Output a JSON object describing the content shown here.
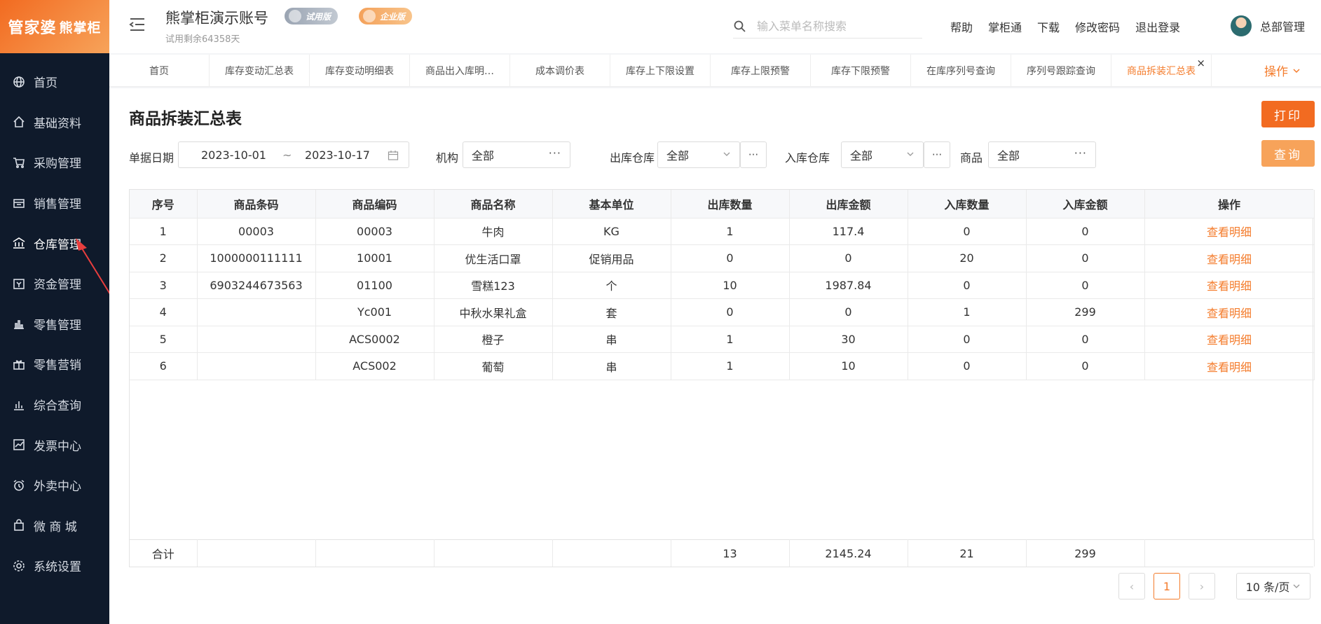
{
  "logo": {
    "text1": "管家婆",
    "text2": "熊掌柜"
  },
  "sidebar": {
    "items": [
      {
        "label": "首页",
        "icon": "globe-icon"
      },
      {
        "label": "基础资料",
        "icon": "home-icon"
      },
      {
        "label": "采购管理",
        "icon": "cart-icon"
      },
      {
        "label": "销售管理",
        "icon": "sales-icon"
      },
      {
        "label": "仓库管理",
        "icon": "bank-icon"
      },
      {
        "label": "资金管理",
        "icon": "money-icon"
      },
      {
        "label": "零售管理",
        "icon": "bar-chart-icon"
      },
      {
        "label": "零售营销",
        "icon": "gift-icon"
      },
      {
        "label": "综合查询",
        "icon": "stats-icon"
      },
      {
        "label": "发票中心",
        "icon": "line-chart-icon"
      },
      {
        "label": "外卖中心",
        "icon": "alarm-icon"
      },
      {
        "label": "微 商 城",
        "icon": "bag-icon"
      },
      {
        "label": "系统设置",
        "icon": "gear-icon"
      }
    ],
    "active_index": 4
  },
  "header": {
    "account_title": "熊掌柜演示账号",
    "trial_text": "试用剩余64358天",
    "badge_trial": "试用版",
    "badge_enterprise": "企业版",
    "search_placeholder": "输入菜单名称搜索",
    "links": [
      "帮助",
      "掌柜通",
      "下载",
      "修改密码",
      "退出登录"
    ],
    "user_name": "总部管理"
  },
  "tabs": {
    "items": [
      "首页",
      "库存变动汇总表",
      "库存变动明细表",
      "商品出入库明…",
      "成本调价表",
      "库存上下限设置",
      "库存上限预警",
      "库存下限预警",
      "在库序列号查询",
      "序列号跟踪查询",
      "商品拆装汇总表"
    ],
    "active_index": 10,
    "close_glyph": "×",
    "action_label": "操作"
  },
  "main": {
    "title": "商品拆装汇总表",
    "print_label": "打印",
    "query_label": "查询"
  },
  "filters": {
    "date_label": "单据日期",
    "date_start": "2023-10-01",
    "date_sep": "~",
    "date_end": "2023-10-17",
    "org_label": "机构",
    "org_value": "全部",
    "out_wh_label": "出库仓库",
    "out_wh_value": "全部",
    "in_wh_label": "入库仓库",
    "in_wh_value": "全部",
    "goods_label": "商品",
    "goods_value": "全部",
    "dots": "···"
  },
  "table": {
    "columns": [
      "序号",
      "商品条码",
      "商品编码",
      "商品名称",
      "基本单位",
      "出库数量",
      "出库金额",
      "入库数量",
      "入库金额",
      "操作"
    ],
    "rows": [
      [
        "1",
        "00003",
        "00003",
        "牛肉",
        "KG",
        "1",
        "117.4",
        "0",
        "0",
        "查看明细"
      ],
      [
        "2",
        "1000000111111",
        "10001",
        "优生活口罩",
        "促销用品",
        "0",
        "0",
        "20",
        "0",
        "查看明细"
      ],
      [
        "3",
        "6903244673563",
        "01100",
        "雪糕123",
        "个",
        "10",
        "1987.84",
        "0",
        "0",
        "查看明细"
      ],
      [
        "4",
        "",
        "Yc001",
        "中秋水果礼盒",
        "套",
        "0",
        "0",
        "1",
        "299",
        "查看明细"
      ],
      [
        "5",
        "",
        "ACS0002",
        "橙子",
        "串",
        "1",
        "30",
        "0",
        "0",
        "查看明细"
      ],
      [
        "6",
        "",
        "ACS002",
        "葡萄",
        "串",
        "1",
        "10",
        "0",
        "0",
        "查看明细"
      ]
    ],
    "footer": [
      "合计",
      "",
      "",
      "",
      "",
      "13",
      "2145.24",
      "21",
      "299",
      ""
    ]
  },
  "pagination": {
    "prev": "‹",
    "current": "1",
    "next": "›",
    "page_size": "10 条/页"
  },
  "colors": {
    "accent": "#f47c2c",
    "sidebar_bg": "#0f1a2b",
    "print_btn": "#f26b21",
    "query_btn": "#f7a35a",
    "annotation_arrow": "#e83e3e"
  }
}
